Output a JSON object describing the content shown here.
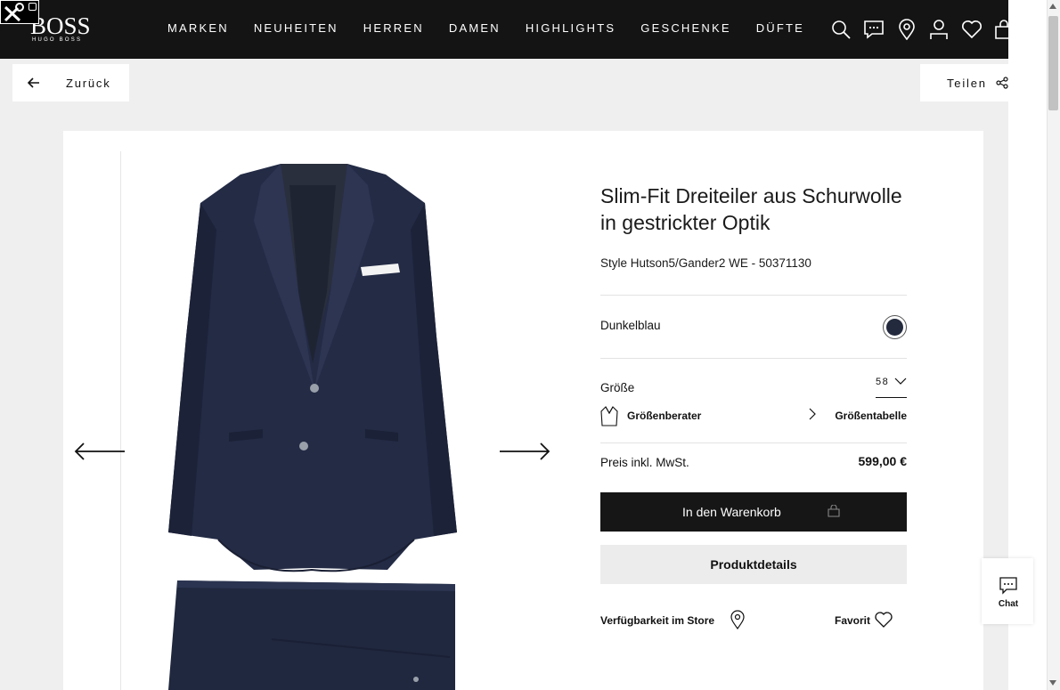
{
  "brand": {
    "name": "BOSS",
    "sub": "HUGO BOSS"
  },
  "nav": {
    "items": [
      "MARKEN",
      "NEUHEITEN",
      "HERREN",
      "DAMEN",
      "HIGHLIGHTS",
      "GESCHENKE",
      "DÜFTE"
    ]
  },
  "header_icons": [
    "search-icon",
    "chat-bubble-icon",
    "location-pin-icon",
    "user-icon",
    "heart-icon",
    "shopping-bag-icon"
  ],
  "back": {
    "label": "Zurück"
  },
  "share": {
    "label": "Teilen"
  },
  "product": {
    "title": "Slim-Fit Dreiteiler aus Schurwolle in gestrickter Optik",
    "style": "Style Hutson5/Gander2 WE - 50371130",
    "color_name": "Dunkelblau",
    "color_hex": "#232a3d",
    "size_label": "Größe",
    "size_value": "58",
    "size_advisor": "Größenberater",
    "size_chart": "Größentabelle",
    "price_label": "Preis inkl. MwSt.",
    "price": "599,00 €",
    "cart_button": "In den Warenkorb",
    "details_button": "Produktdetails",
    "store_availability": "Verfügbarkeit im Store",
    "favorite": "Favorit"
  },
  "chat": {
    "label": "Chat"
  }
}
